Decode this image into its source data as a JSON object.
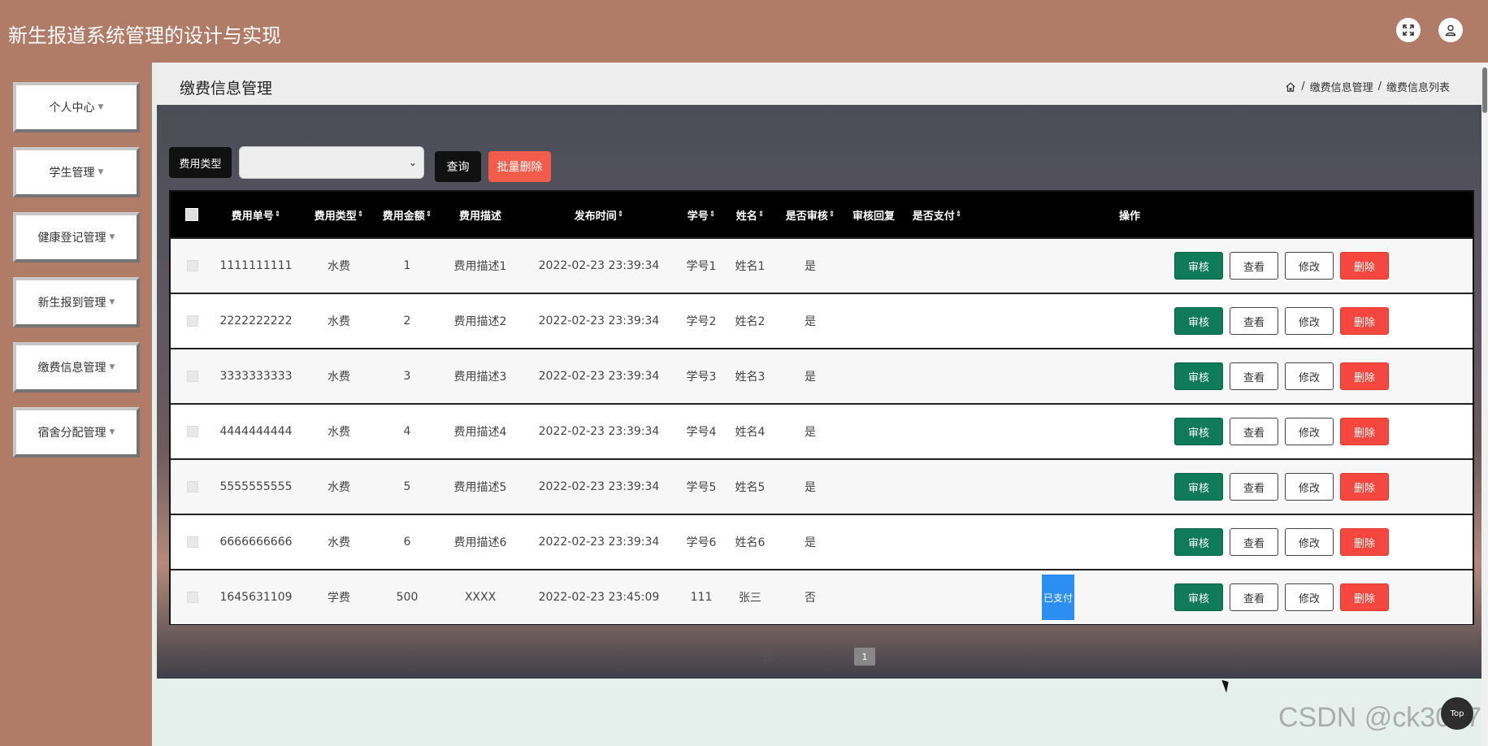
{
  "app": {
    "title": "新生报道系统管理的设计与实现"
  },
  "sidebar": {
    "items": [
      {
        "label": "个人中心"
      },
      {
        "label": "学生管理"
      },
      {
        "label": "健康登记管理"
      },
      {
        "label": "新生报到管理"
      },
      {
        "label": "缴费信息管理"
      },
      {
        "label": "宿舍分配管理"
      }
    ]
  },
  "page": {
    "title": "缴费信息管理",
    "breadcrumb": [
      "缴费信息管理",
      "缴费信息列表"
    ],
    "breadcrumb_sep": "/"
  },
  "filter": {
    "label": "费用类型",
    "select_value": "",
    "query_label": "查询",
    "batch_delete_label": "批量删除"
  },
  "table": {
    "headers": {
      "order_no": "费用单号",
      "fee_type": "费用类型",
      "amount": "费用金额",
      "description": "费用描述",
      "publish_time": "发布时间",
      "student_no": "学号",
      "name": "姓名",
      "audited": "是否审核",
      "audit_reply": "审核回复",
      "paid": "是否支付",
      "actions": "操作"
    },
    "sort_glyph": "⇕",
    "action_labels": {
      "audit": "审核",
      "view": "查看",
      "edit": "修改",
      "delete": "删除"
    },
    "rows": [
      {
        "order_no": "1111111111",
        "fee_type": "水费",
        "amount": "1",
        "description": "费用描述1",
        "publish_time": "2022-02-23 23:39:34",
        "student_no": "学号1",
        "name": "姓名1",
        "audited": "是",
        "audit_reply": "",
        "paid": ""
      },
      {
        "order_no": "2222222222",
        "fee_type": "水费",
        "amount": "2",
        "description": "费用描述2",
        "publish_time": "2022-02-23 23:39:34",
        "student_no": "学号2",
        "name": "姓名2",
        "audited": "是",
        "audit_reply": "",
        "paid": ""
      },
      {
        "order_no": "3333333333",
        "fee_type": "水费",
        "amount": "3",
        "description": "费用描述3",
        "publish_time": "2022-02-23 23:39:34",
        "student_no": "学号3",
        "name": "姓名3",
        "audited": "是",
        "audit_reply": "",
        "paid": ""
      },
      {
        "order_no": "4444444444",
        "fee_type": "水费",
        "amount": "4",
        "description": "费用描述4",
        "publish_time": "2022-02-23 23:39:34",
        "student_no": "学号4",
        "name": "姓名4",
        "audited": "是",
        "audit_reply": "",
        "paid": ""
      },
      {
        "order_no": "5555555555",
        "fee_type": "水费",
        "amount": "5",
        "description": "费用描述5",
        "publish_time": "2022-02-23 23:39:34",
        "student_no": "学号5",
        "name": "姓名5",
        "audited": "是",
        "audit_reply": "",
        "paid": ""
      },
      {
        "order_no": "6666666666",
        "fee_type": "水费",
        "amount": "6",
        "description": "费用描述6",
        "publish_time": "2022-02-23 23:39:34",
        "student_no": "学号6",
        "name": "姓名6",
        "audited": "是",
        "audit_reply": "",
        "paid": ""
      },
      {
        "order_no": "1645631109",
        "fee_type": "学费",
        "amount": "500",
        "description": "XXXX",
        "publish_time": "2022-02-23 23:45:09",
        "student_no": "111",
        "name": "张三",
        "audited": "否",
        "audit_reply": "",
        "paid": "已支付"
      }
    ]
  },
  "pager": {
    "page_size": "10",
    "current_page": "1"
  },
  "top_button": {
    "label": "Top"
  },
  "watermark": {
    "text": "CSDN @ck3017"
  },
  "colors": {
    "header_bg": "#b07c68",
    "audit_button": "#0f7b59",
    "delete_button": "#f5473d",
    "paid_badge": "#2a8ff0"
  },
  "icons": {
    "fullscreen": "expand-icon",
    "user": "user-icon",
    "home": "home-icon",
    "caret": "caret-down-icon"
  }
}
